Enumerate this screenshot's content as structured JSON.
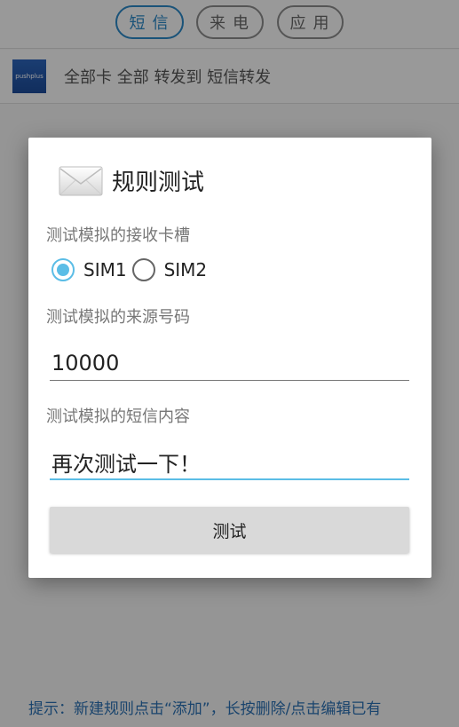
{
  "tabs": [
    {
      "label": "短信",
      "active": true
    },
    {
      "label": "来电",
      "active": false
    },
    {
      "label": "应用",
      "active": false
    }
  ],
  "rule_item": {
    "logo_text": "pushplus",
    "text": "全部卡 全部 转发到  短信转发"
  },
  "hint": "提示：新建规则点击“添加”，长按删除/点击编辑已有",
  "dialog": {
    "title": "规则测试",
    "icon": "envelope-icon",
    "sim_label": "测试模拟的接收卡槽",
    "sim_options": [
      "SIM1",
      "SIM2"
    ],
    "sim_selected": "SIM1",
    "from_label": "测试模拟的来源号码",
    "from_value": "10000",
    "content_label": "测试模拟的短信内容",
    "content_value": "再次测试一下！",
    "test_button": "测试"
  },
  "colors": {
    "accent": "#5bbde6",
    "tab_active": "#2a86c4",
    "hint": "#2a6fb0"
  }
}
